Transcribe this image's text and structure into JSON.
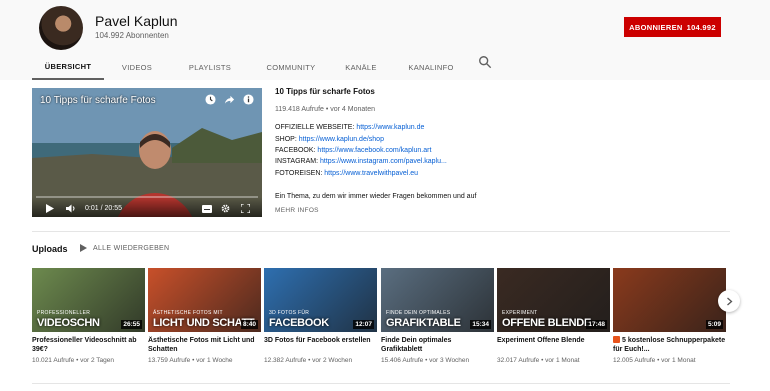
{
  "channel": {
    "name": "Pavel Kaplun",
    "subscribers": "104.992 Abonnenten",
    "subscribe_label": "ABONNIEREN",
    "subscribe_count": "104.992"
  },
  "tabs": [
    {
      "label": "ÜBERSICHT",
      "active": true
    },
    {
      "label": "VIDEOS"
    },
    {
      "label": "PLAYLISTS"
    },
    {
      "label": "COMMUNITY"
    },
    {
      "label": "KANÄLE"
    },
    {
      "label": "KANALINFO"
    }
  ],
  "featured": {
    "overlay_title": "10 Tipps für scharfe Fotos",
    "title": "10 Tipps für scharfe Fotos",
    "meta": "119.418 Aufrufe • vor 4 Monaten",
    "time": "0:01 / 20:55",
    "lines": [
      {
        "label": "OFFIZIELLE WEBSEITE:",
        "link": "https://www.kaplun.de"
      },
      {
        "label": "SHOP:",
        "link": "https://www.kaplun.de/shop"
      },
      {
        "label": "FACEBOOK:",
        "link": "https://www.facebook.com/kaplun.art"
      },
      {
        "label": "INSTAGRAM:",
        "link": "https://www.instagram.com/pavel.kaplu..."
      },
      {
        "label": "FOTOREISEN:",
        "link": "https://www.travelwithpavel.eu"
      }
    ],
    "description": "Ein Thema, zu dem wir immer wieder Fragen bekommen und auf",
    "more": "MEHR INFOS"
  },
  "uploads": {
    "title": "Uploads",
    "play_all": "ALLE WIEDERGEBEN",
    "videos": [
      {
        "thumb_sub": "PROFESSIONELLER",
        "thumb_text": "VIDEOSCHN",
        "duration": "26:55",
        "title": "Professioneller Videoschnitt ab 39€?",
        "meta": "10.021 Aufrufe • vor 2 Tagen",
        "bg": "#6d8a4e"
      },
      {
        "thumb_sub": "ÄSTHETISCHE FOTOS MIT",
        "thumb_text": "LICHT UND SCHATT",
        "duration": "8:40",
        "title": "Ästhetische Fotos mit Licht und Schatten",
        "meta": "13.759 Aufrufe • vor 1 Woche",
        "bg": "#c8502a"
      },
      {
        "thumb_sub": "3D FOTOS FÜR",
        "thumb_text": "FACEBOOK",
        "duration": "12:07",
        "title": "3D Fotos für Facebook erstellen",
        "meta": "12.382 Aufrufe • vor 2 Wochen",
        "bg": "#2e6fb0"
      },
      {
        "thumb_sub": "FINDE DEIN OPTIMALES",
        "thumb_text": "GRAFIKTABLE",
        "duration": "15:34",
        "title": "Finde Dein optimales Grafiktablett",
        "meta": "15.406 Aufrufe • vor 3 Wochen",
        "bg": "#5a6e80"
      },
      {
        "thumb_sub": "EXPERIMENT",
        "thumb_text": "OFFENE BLENDE",
        "duration": "17:48",
        "title": "Experiment Offene Blende",
        "meta": "32.017 Aufrufe • vor 1 Monat",
        "bg": "#3a2a22"
      },
      {
        "thumb_sub": "",
        "thumb_text": "",
        "duration": "5:09",
        "title": "5 kostenlose Schnupperpakete für Euch!...",
        "meta": "12.005 Aufrufe • vor 1 Monat",
        "bg": "#8a3a1c"
      }
    ]
  },
  "colors": {
    "accent": "#cc0000",
    "link": "#065fd4"
  }
}
